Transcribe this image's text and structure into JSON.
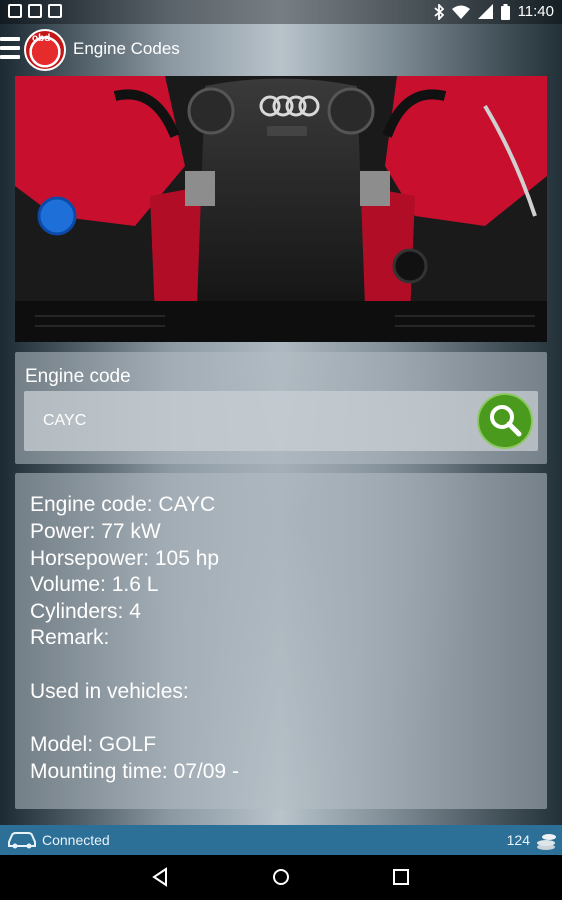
{
  "status_bar": {
    "time": "11:40",
    "icons": [
      "image-icon",
      "download-icon",
      "bag-icon",
      "bluetooth-icon",
      "wifi-icon",
      "signal-icon",
      "battery-icon"
    ]
  },
  "app_bar": {
    "title": "Engine Codes",
    "logo_text": "obd"
  },
  "search": {
    "label": "Engine code",
    "value": "CAYC",
    "button_icon": "search-icon"
  },
  "result": {
    "lines": [
      "Engine code: CAYC",
      "Power: 77 kW",
      "Horsepower: 105 hp",
      "Volume: 1.6 L",
      "Cylinders: 4",
      "Remark:",
      "",
      "Used in vehicles:",
      "",
      "Model: GOLF",
      "Mounting time: 07/09 -"
    ]
  },
  "bottom_status": {
    "connection": "Connected",
    "credits": "124"
  },
  "colors": {
    "accent_green": "#4a9a1d",
    "status_blue": "#2c6f97",
    "engine_red": "#c8102e"
  }
}
